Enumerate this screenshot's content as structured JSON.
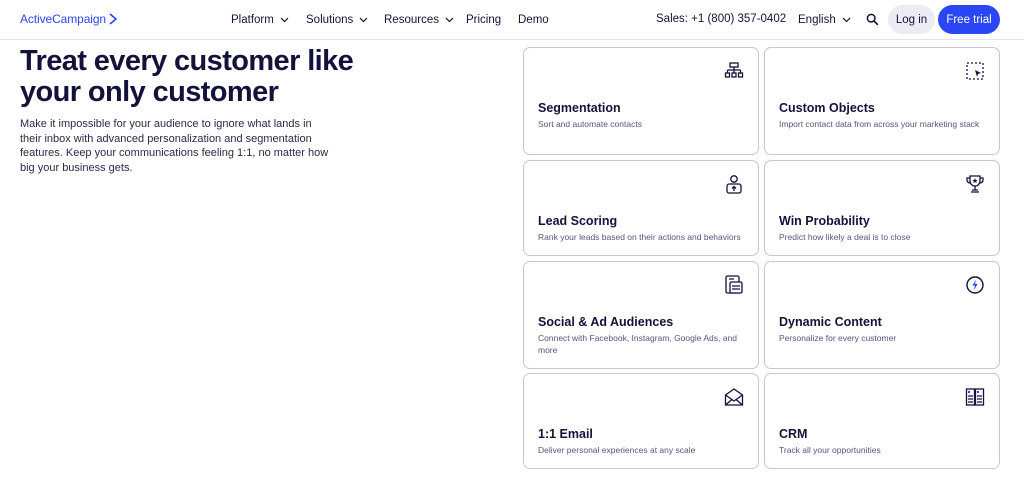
{
  "nav": {
    "logo": "ActiveCampaign",
    "menu": [
      {
        "label": "Platform"
      },
      {
        "label": "Solutions"
      },
      {
        "label": "Resources"
      },
      {
        "label": "Pricing"
      },
      {
        "label": "Demo"
      }
    ],
    "sales": "Sales: +1 (800) 357-0402",
    "language": "English",
    "login_label": "Log in",
    "trial_label": "Free trial"
  },
  "hero": {
    "headline": "Treat every customer like your only customer",
    "subtext": "Make it impossible for your audience to ignore what lands in their inbox with advanced personalization and segmentation features. Keep your communications feeling 1:1, no matter how big your business gets."
  },
  "cards": [
    {
      "title": "Segmentation",
      "description": "Sort and automate contacts",
      "icon": "hierarchy-icon"
    },
    {
      "title": "Custom Objects",
      "description": "Import contact data from across your marketing stack",
      "icon": "selection-cursor-icon"
    },
    {
      "title": "Lead Scoring",
      "description": "Rank your leads based on their actions and behaviors",
      "icon": "person-score-icon"
    },
    {
      "title": "Win Probability",
      "description": "Predict how likely a deal is to close",
      "icon": "trophy-icon"
    },
    {
      "title": "Social & Ad Audiences",
      "description": "Connect with Facebook, Instagram, Google Ads, and more",
      "icon": "clipboard-list-icon"
    },
    {
      "title": "Dynamic Content",
      "description": "Personalize for every customer",
      "icon": "lightning-badge-icon"
    },
    {
      "title": "1:1 Email",
      "description": "Deliver personal experiences at any scale",
      "icon": "envelope-icon"
    },
    {
      "title": "CRM",
      "description": "Track all your opportunities",
      "icon": "columns-icon"
    }
  ],
  "colors": {
    "brand_blue": "#2a46f5",
    "text_dark": "#13123a",
    "text_muted": "#56557a",
    "card_border": "#c7c7d1",
    "login_bg": "#ececf2"
  }
}
